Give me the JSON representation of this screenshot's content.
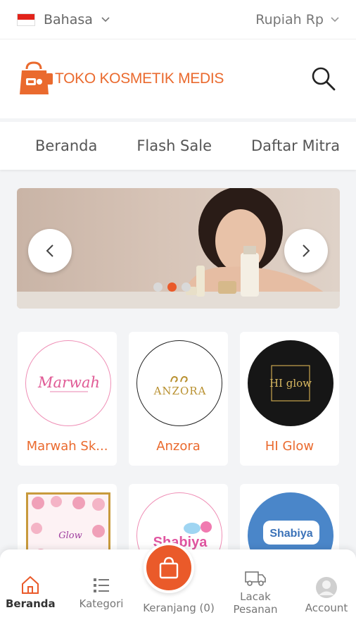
{
  "topbar": {
    "language_label": "Bahasa",
    "currency_label": "Rupiah Rp"
  },
  "header": {
    "brand_name": "TOKO KOSMETIK MEDIS"
  },
  "nav_tabs": [
    "Beranda",
    "Flash Sale",
    "Daftar Mitra"
  ],
  "banner": {
    "slide_count": 3,
    "active_slide": 2
  },
  "brands": [
    {
      "name": "Marwah Sk...",
      "logo_text": "Marwah"
    },
    {
      "name": "Anzora",
      "logo_text": "ANZORA"
    },
    {
      "name": "HI Glow",
      "logo_text": "HI glow"
    },
    {
      "name": "",
      "logo_text": "Glow"
    },
    {
      "name": "",
      "logo_text": "Shabiya"
    },
    {
      "name": "",
      "logo_text": "Shabiya"
    }
  ],
  "bottom_nav": {
    "home": "Beranda",
    "category": "Kategori",
    "cart": "Keranjang (0)",
    "track_line1": "Lacak",
    "track_line2": "Pesanan",
    "account": "Account"
  },
  "colors": {
    "accent": "#ea5a2a",
    "brand_text": "#ea6a2e"
  }
}
